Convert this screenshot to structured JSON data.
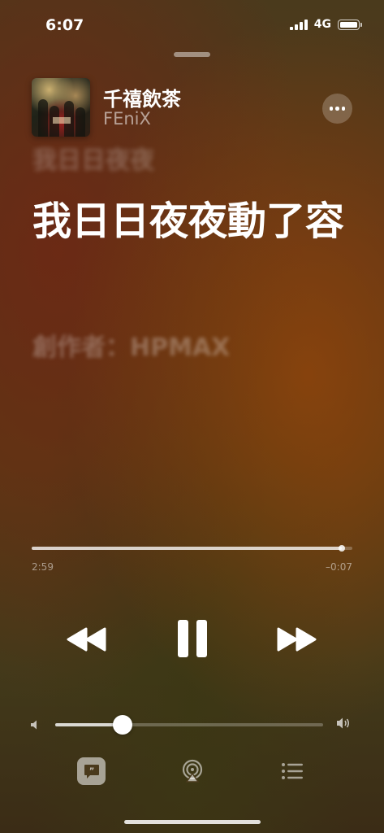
{
  "status_bar": {
    "time": "6:07",
    "network": "4G",
    "icons": [
      "signal-icon",
      "battery-icon"
    ]
  },
  "now_playing": {
    "title": "千禧飲茶",
    "artist": "FEniX"
  },
  "lyrics": {
    "previous": "我日日夜夜",
    "current": "我日日夜夜動了容",
    "next": "創作者：HPMAX"
  },
  "playback": {
    "elapsed": "2:59",
    "remaining": "–0:07",
    "progress_fraction": 0.967,
    "state": "playing"
  },
  "volume": {
    "level_fraction": 0.25
  },
  "bottom_bar": {
    "active": "lyrics",
    "icons": [
      "lyrics-icon",
      "airplay-icon",
      "queue-icon"
    ]
  },
  "colors": {
    "accent": "#ffffff",
    "background_warm": "#5a3418",
    "background_olive": "#423a1a"
  }
}
